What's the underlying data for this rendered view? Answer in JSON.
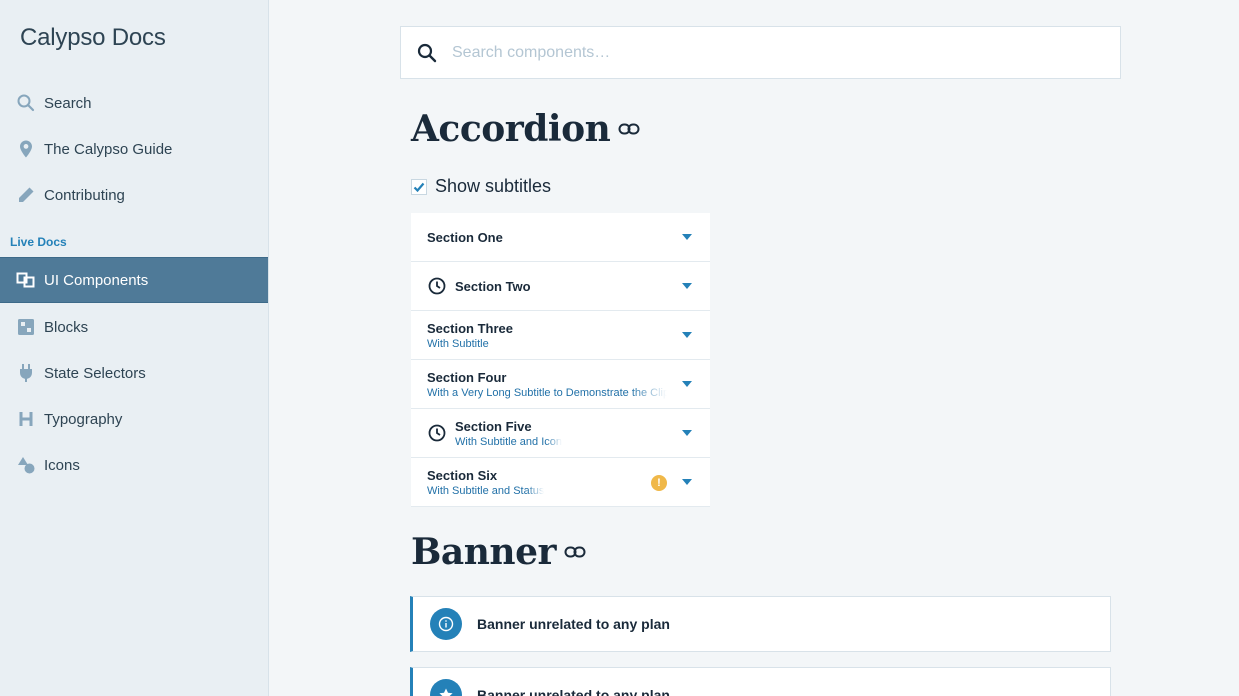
{
  "sidebar": {
    "app_title": "Calypso Docs",
    "items": [
      {
        "label": "Search",
        "icon": "search-icon"
      },
      {
        "label": "The Calypso Guide",
        "icon": "location-pin-icon"
      },
      {
        "label": "Contributing",
        "icon": "pencil-icon"
      }
    ],
    "section_label": "Live Docs",
    "live_items": [
      {
        "label": "UI Components",
        "icon": "components-icon",
        "active": true
      },
      {
        "label": "Blocks",
        "icon": "blocks-icon"
      },
      {
        "label": "State Selectors",
        "icon": "plug-icon"
      },
      {
        "label": "Typography",
        "icon": "heading-icon"
      },
      {
        "label": "Icons",
        "icon": "shapes-icon"
      }
    ]
  },
  "search": {
    "placeholder": "Search components…"
  },
  "accordion_section": {
    "title": "Accordion",
    "show_subtitles_label": "Show subtitles",
    "show_subtitles_checked": true,
    "items": [
      {
        "title": "Section One",
        "subtitle": ""
      },
      {
        "title": "Section Two",
        "subtitle": "",
        "icon": "clock-icon"
      },
      {
        "title": "Section Three",
        "subtitle": "With Subtitle"
      },
      {
        "title": "Section Four",
        "subtitle": "With a Very Long Subtitle to Demonstrate the Clipping"
      },
      {
        "title": "Section Five",
        "subtitle": "With Subtitle and Icon",
        "icon": "clock-icon"
      },
      {
        "title": "Section Six",
        "subtitle": "With Subtitle and Status",
        "status": "!"
      }
    ]
  },
  "banner_section": {
    "title": "Banner",
    "banners": [
      {
        "text": "Banner unrelated to any plan"
      },
      {
        "text": "Banner unrelated to any plan"
      }
    ]
  },
  "colors": {
    "accent": "#2481b8",
    "active_nav": "#4f7a98",
    "status_warning": "#f0b849"
  }
}
